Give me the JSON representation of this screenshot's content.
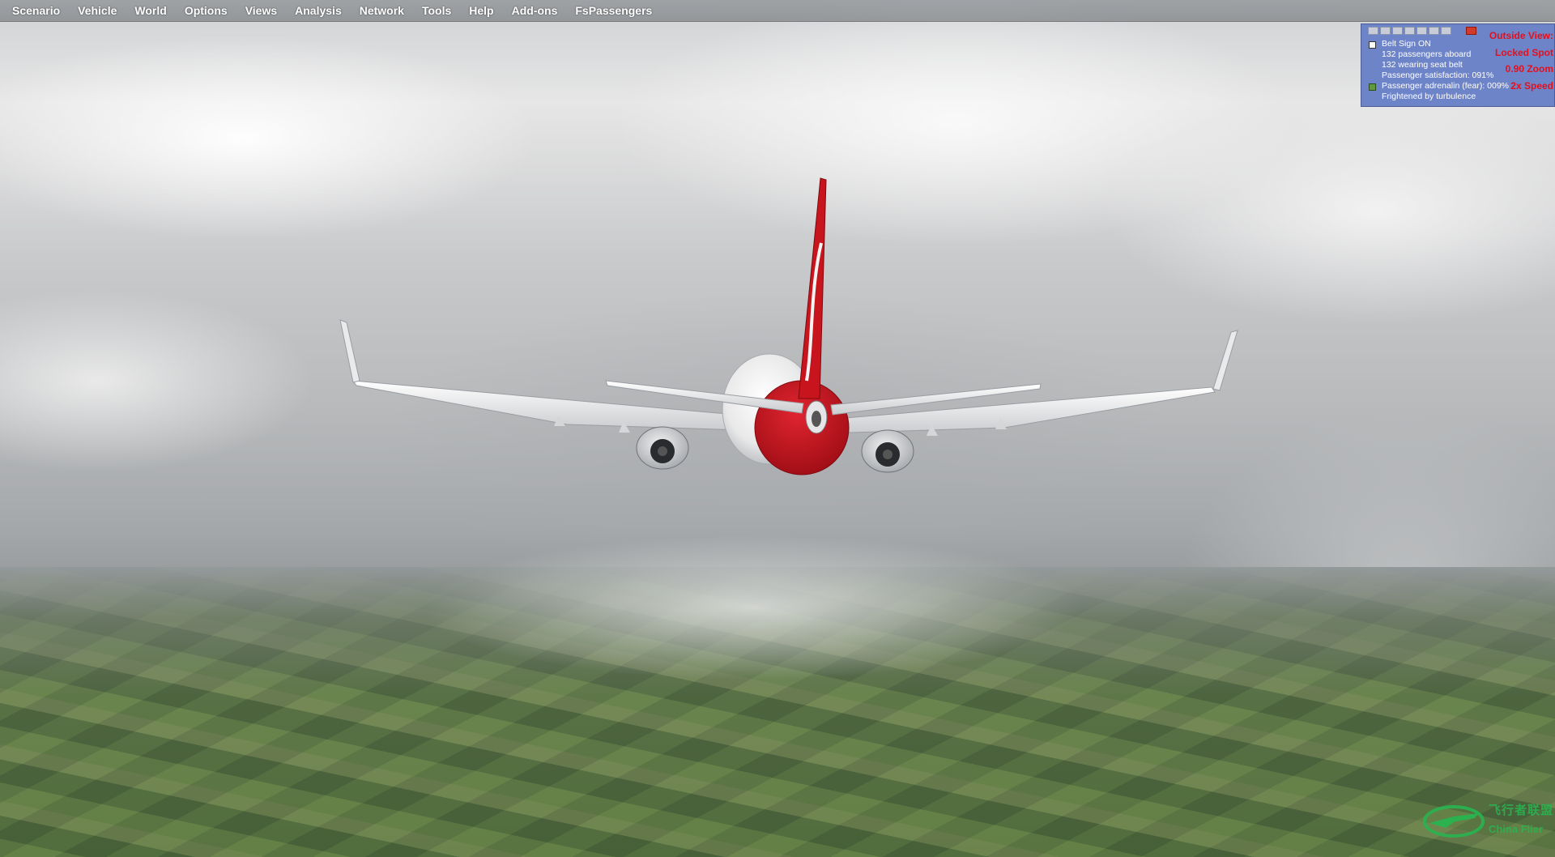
{
  "menubar": {
    "items": [
      {
        "label": "Scenario"
      },
      {
        "label": "Vehicle"
      },
      {
        "label": "World"
      },
      {
        "label": "Options"
      },
      {
        "label": "Views"
      },
      {
        "label": "Analysis"
      },
      {
        "label": "Network"
      },
      {
        "label": "Tools"
      },
      {
        "label": "Help"
      },
      {
        "label": "Add-ons"
      },
      {
        "label": "FsPassengers"
      }
    ]
  },
  "fspassengers": {
    "lines": [
      "Belt Sign ON",
      "132 passengers aboard",
      "132 wearing seat belt",
      "Passenger satisfaction: 091%",
      "Passenger adrenalin (fear): 009%",
      "Frightened by turbulence"
    ],
    "belt_indicator_color": "#ffffff",
    "adrenalin_indicator_color": "#5c9a3c",
    "panel_color": "#6e84c8"
  },
  "view_info": {
    "title": "Outside View:",
    "mode": "Locked Spot",
    "zoom": "0.90 Zoom",
    "speed": "2x Speed",
    "color": "#e3101c"
  },
  "watermark": {
    "chinese": "飞行者联盟",
    "english": "China Flier"
  },
  "aircraft": {
    "livery_colors": {
      "tail": "#c8141c",
      "fuselage": "#f4f4f4",
      "engine": "#d9dadc"
    }
  }
}
